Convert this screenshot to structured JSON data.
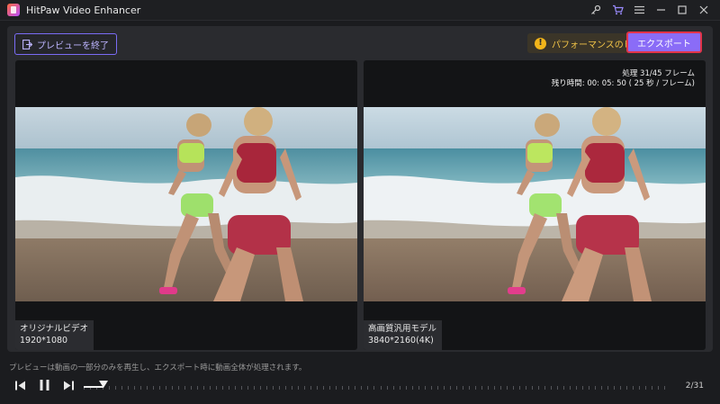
{
  "app": {
    "title": "HitPaw Video Enhancer"
  },
  "titlebar_icons": [
    "key-icon",
    "cart-icon",
    "menu-icon",
    "minimize-icon",
    "maximize-icon",
    "close-icon"
  ],
  "toolbar": {
    "exit_preview_label": "プレビューを終了",
    "performance_tips_label": "パフォーマンスのヒント",
    "export_label": "エクスポート"
  },
  "progress": {
    "processed": "処理 31/45 フレーム",
    "remaining": "残り時間: 00: 05: 50 ( 25 秒 / フレーム)"
  },
  "left_video": {
    "title": "オリジナルビデオ",
    "resolution": "1920*1080"
  },
  "right_video": {
    "title": "高画質汎用モデル",
    "resolution": "3840*2160(4K)"
  },
  "footer": {
    "hint": "プレビューは動画の一部分のみを再生し、エクスポート時に動画全体が処理されます。",
    "frame_counter": "2/31",
    "current_frame": 2,
    "total_frames": 31
  },
  "colors": {
    "accent": "#8a6cf7",
    "export_border": "#e2344a",
    "warning": "#f2b51a",
    "exit_border": "#7a6cf5"
  }
}
